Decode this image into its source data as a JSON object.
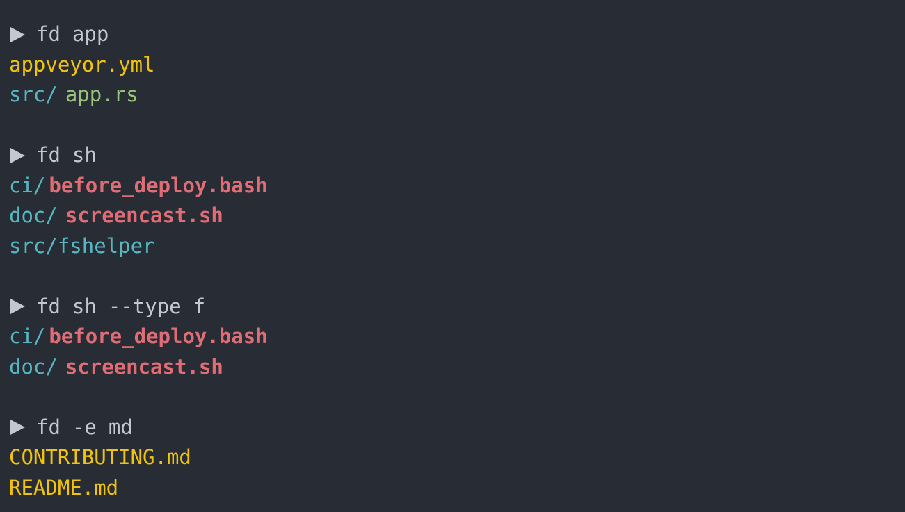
{
  "terminal": {
    "blocks": [
      {
        "command": [
          "fd",
          "app"
        ],
        "results": [
          {
            "dir": "",
            "name": "appveyor.yml",
            "kind": "yellow"
          },
          {
            "dir": "src/",
            "name": "app.rs",
            "kind": "green"
          }
        ]
      },
      {
        "command": [
          "fd",
          "sh"
        ],
        "results": [
          {
            "dir": "ci/",
            "name": "before_deploy.bash",
            "kind": "red"
          },
          {
            "dir": "doc/",
            "name": "screencast.sh",
            "kind": "red"
          },
          {
            "dir": "src/",
            "name": "fshelper",
            "kind": "cyan-file"
          }
        ]
      },
      {
        "command": [
          "fd",
          "sh",
          "--type",
          "f"
        ],
        "results": [
          {
            "dir": "ci/",
            "name": "before_deploy.bash",
            "kind": "red"
          },
          {
            "dir": "doc/",
            "name": "screencast.sh",
            "kind": "red"
          }
        ]
      },
      {
        "command": [
          "fd",
          "-e",
          "md"
        ],
        "results": [
          {
            "dir": "",
            "name": "CONTRIBUTING.md",
            "kind": "yellow"
          },
          {
            "dir": "",
            "name": "README.md",
            "kind": "yellow"
          }
        ]
      }
    ]
  },
  "colors": {
    "background": "#282c34",
    "text": "#c2c8d2",
    "directory": "#56b6c2",
    "config_file": "#f0c30f",
    "source_file": "#98c379",
    "executable": "#e06c75"
  },
  "icons": {
    "prompt": "prompt-arrow-icon"
  }
}
